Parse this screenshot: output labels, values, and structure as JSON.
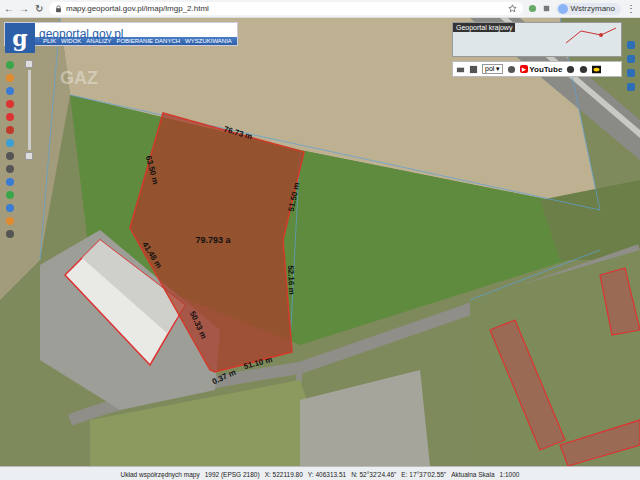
{
  "browser": {
    "back": "←",
    "forward": "→",
    "reload": "↻",
    "url": "mapy.geoportal.gov.pl/imap/lmgp_2.html",
    "profile": "Wstrzymano",
    "more": "⋮"
  },
  "app": {
    "logo_letter": "g",
    "logo_text": "geoportal.gov.pl",
    "menu": [
      "PLIK",
      "WIDOK",
      "ANALIZY",
      "POBIERANIE DANYCH",
      "WYSZUKIWANIA"
    ],
    "watermark": "GAZ"
  },
  "overview": {
    "title": "Geoportal krajowy"
  },
  "toolbar": {
    "language": "pol",
    "youtube": "YouTube"
  },
  "parcel": {
    "area": "79.793 a",
    "dimensions": [
      "76.73 m",
      "63.50 m",
      "51.50 m",
      "41.48 m",
      "52.16 m",
      "50.33 m",
      "0.37 m",
      "51.10 m"
    ]
  },
  "status_bar": {
    "crs_label": "Układ współrzędnych mapy",
    "crs": "1992 (EPSG 2180)",
    "x": "X: 522119.80",
    "y": "Y: 406313.51",
    "n": "N: 52°32'24.46\"",
    "e": "E: 17°37'02.55\"",
    "scale_label": "Aktualna Skala",
    "scale": "1:1000"
  }
}
